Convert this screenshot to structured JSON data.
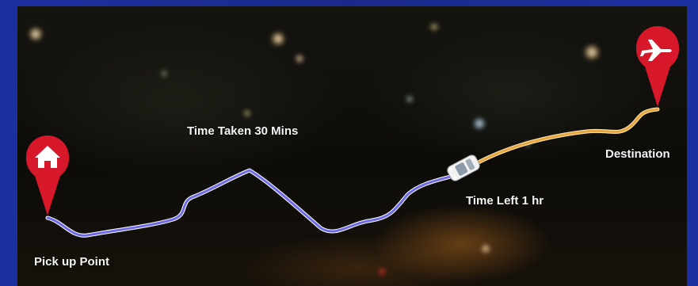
{
  "labels": {
    "pickup": "Pick up Point",
    "time_taken": "Time Taken 30 Mins",
    "time_left": "Time Left 1 hr",
    "destination": "Destination"
  },
  "route_progress": {
    "completed_fraction": 0.66
  },
  "icons": {
    "start_pin": "home-icon",
    "end_pin": "airplane-icon",
    "vehicle": "car-icon"
  },
  "colors": {
    "pin_red": "#d6182a",
    "route_traveled": "#6c6ae8",
    "route_remaining": "#e8a63c",
    "frame_blue": "#1b2a8a"
  }
}
